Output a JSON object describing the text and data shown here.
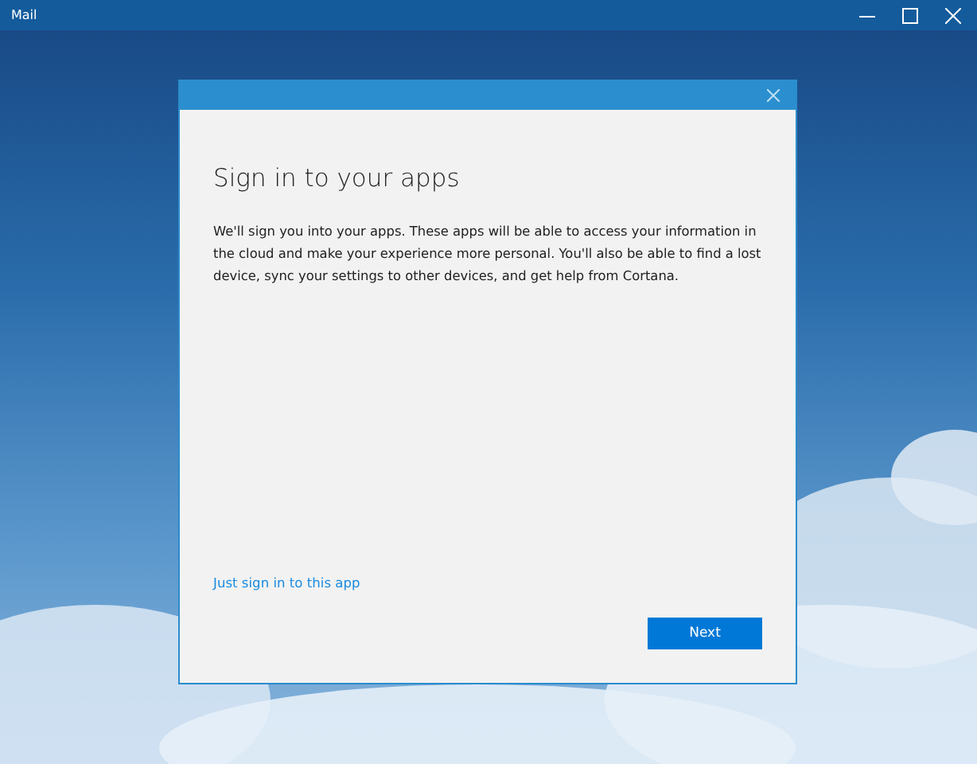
{
  "window": {
    "title": "Mail"
  },
  "dialog": {
    "title": "Sign in to your apps",
    "body": "We'll sign you into your apps. These apps will be able to access your information in the cloud and make your experience more personal. You'll also be able to find a lost device, sync your settings to other devices, and get help from Cortana.",
    "link": "Just sign in to this app",
    "button": "Next"
  }
}
